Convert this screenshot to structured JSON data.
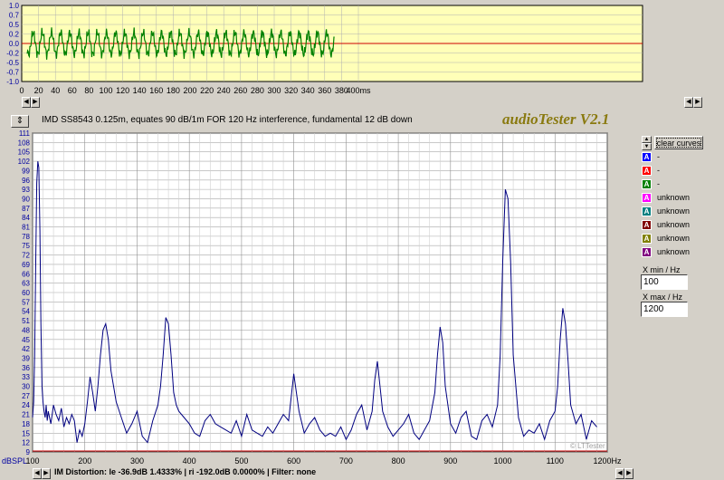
{
  "time_plot": {
    "y_ticks": [
      "1.0",
      "0.7",
      "0.5",
      "0.2",
      "0.0",
      "-0.2",
      "-0.5",
      "-0.7",
      "-1.0"
    ],
    "x_ticks": [
      "0",
      "20",
      "40",
      "60",
      "80",
      "100",
      "120",
      "140",
      "160",
      "180",
      "200",
      "220",
      "240",
      "260",
      "280",
      "300",
      "320",
      "340",
      "360",
      "380",
      "400ms"
    ],
    "bg_color": "#ffffb8",
    "trace_color": "#008000"
  },
  "header": {
    "title": "IMD SS8543 0.125m, equates 90 dB/1m FOR 120 Hz interference, fundamental 12 dB down",
    "brand": "audioTester V2.1"
  },
  "chart_data": {
    "type": "line",
    "title": "IMD SS8543 0.125m, equates 90 dB/1m FOR 120 Hz interference, fundamental 12 dB down",
    "ylabel": "dBSPL",
    "xlim": [
      100,
      1200
    ],
    "ylim": [
      9,
      111
    ],
    "y_ticks": [
      "111",
      "108",
      "105",
      "102",
      "99",
      "96",
      "93",
      "90",
      "87",
      "84",
      "81",
      "78",
      "75",
      "72",
      "69",
      "66",
      "63",
      "60",
      "57",
      "54",
      "51",
      "48",
      "45",
      "42",
      "39",
      "36",
      "33",
      "30",
      "27",
      "24",
      "21",
      "18",
      "15",
      "12",
      "9"
    ],
    "x_ticks": [
      "100",
      "200",
      "300",
      "400",
      "500",
      "600",
      "700",
      "800",
      "900",
      "1000",
      "1100",
      "1200Hz"
    ],
    "grid": true,
    "line_color": "#000080",
    "series": [
      {
        "x": [
          100,
          102,
          104,
          106,
          108,
          110,
          112,
          114,
          116,
          118,
          120,
          122,
          124,
          126,
          128,
          130,
          135,
          140,
          145,
          150,
          155,
          160,
          165,
          170,
          175,
          180,
          185,
          190,
          195,
          200,
          205,
          210,
          215,
          220,
          225,
          230,
          235,
          240,
          245,
          250,
          255,
          260,
          270,
          280,
          290,
          300,
          310,
          320,
          330,
          340,
          345,
          350,
          355,
          360,
          365,
          370,
          375,
          380,
          390,
          400,
          410,
          420,
          430,
          440,
          450,
          460,
          470,
          480,
          490,
          500,
          510,
          520,
          530,
          540,
          550,
          560,
          570,
          580,
          590,
          600,
          610,
          620,
          630,
          640,
          650,
          660,
          670,
          680,
          690,
          700,
          710,
          720,
          730,
          740,
          750,
          755,
          760,
          765,
          770,
          780,
          790,
          800,
          810,
          820,
          830,
          840,
          850,
          860,
          870,
          875,
          880,
          885,
          890,
          900,
          910,
          920,
          930,
          940,
          950,
          960,
          970,
          980,
          990,
          995,
          1000,
          1005,
          1010,
          1015,
          1020,
          1030,
          1040,
          1050,
          1060,
          1070,
          1080,
          1090,
          1100,
          1105,
          1110,
          1115,
          1120,
          1125,
          1130,
          1140,
          1150,
          1160,
          1170,
          1180
        ],
        "y": [
          20,
          25,
          40,
          70,
          95,
          102,
          100,
          80,
          50,
          30,
          25,
          22,
          20,
          24,
          19,
          22,
          18,
          24,
          21,
          19,
          23,
          17,
          20,
          18,
          21,
          19,
          12,
          16,
          14,
          18,
          25,
          33,
          28,
          22,
          30,
          40,
          48,
          50,
          45,
          35,
          30,
          25,
          20,
          15,
          18,
          22,
          14,
          12,
          19,
          24,
          30,
          40,
          52,
          50,
          40,
          28,
          24,
          22,
          20,
          18,
          15,
          14,
          19,
          21,
          18,
          17,
          16,
          15,
          19,
          14,
          21,
          16,
          15,
          14,
          17,
          15,
          18,
          21,
          19,
          34,
          22,
          15,
          18,
          20,
          16,
          14,
          15,
          14,
          17,
          13,
          16,
          21,
          24,
          16,
          22,
          32,
          38,
          30,
          22,
          17,
          14,
          16,
          18,
          21,
          15,
          13,
          16,
          19,
          28,
          40,
          49,
          44,
          30,
          18,
          15,
          20,
          22,
          14,
          13,
          19,
          21,
          17,
          24,
          40,
          70,
          93,
          90,
          70,
          40,
          20,
          14,
          16,
          15,
          18,
          13,
          19,
          22,
          30,
          45,
          55,
          50,
          38,
          24,
          18,
          21,
          13,
          19,
          17
        ]
      }
    ]
  },
  "legend": {
    "clear_label": "clear curves",
    "items": [
      {
        "glyph": "A",
        "color": "#0000ff",
        "label": "-"
      },
      {
        "glyph": "A",
        "color": "#ff0000",
        "label": "-"
      },
      {
        "glyph": "A",
        "color": "#008000",
        "label": "-"
      },
      {
        "glyph": "A",
        "color": "#ff00ff",
        "label": "unknown"
      },
      {
        "glyph": "A",
        "color": "#008080",
        "label": "unknown"
      },
      {
        "glyph": "A",
        "color": "#800000",
        "label": "unknown"
      },
      {
        "glyph": "A",
        "color": "#808000",
        "label": "unknown"
      },
      {
        "glyph": "A",
        "color": "#800080",
        "label": "unknown"
      }
    ]
  },
  "controls": {
    "xmin_label": "X min / Hz",
    "xmin_value": "100",
    "xmax_label": "X max / Hz",
    "xmax_value": "1200"
  },
  "status": {
    "left": "dBSPL",
    "text": "IM Distortion:  le -36.9dB  1.4333% | ri -192.0dB  0.0000% |    Filter: none"
  },
  "watermark": "© LTTester",
  "icons": {
    "scroll_left": "triangle-left",
    "scroll_right": "triangle-right",
    "spin": "up-down-arrows"
  }
}
